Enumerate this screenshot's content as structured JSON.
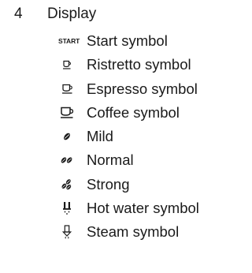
{
  "section": {
    "number": "4",
    "title": "Display"
  },
  "symbols": [
    {
      "icon": "start-text-icon",
      "icon_text": "START",
      "label": "Start symbol"
    },
    {
      "icon": "ristretto-cup-icon",
      "label": "Ristretto symbol"
    },
    {
      "icon": "espresso-cup-icon",
      "label": "Espresso symbol"
    },
    {
      "icon": "coffee-cup-icon",
      "label": "Coffee symbol"
    },
    {
      "icon": "coffee-bean-one-icon",
      "label": "Mild"
    },
    {
      "icon": "coffee-bean-two-icon",
      "label": "Normal"
    },
    {
      "icon": "coffee-bean-three-icon",
      "label": "Strong"
    },
    {
      "icon": "hot-water-icon",
      "label": "Hot water symbol"
    },
    {
      "icon": "steam-icon",
      "label": "Steam symbol"
    }
  ],
  "colors": {
    "text": "#1a1a1a",
    "background": "#ffffff"
  }
}
